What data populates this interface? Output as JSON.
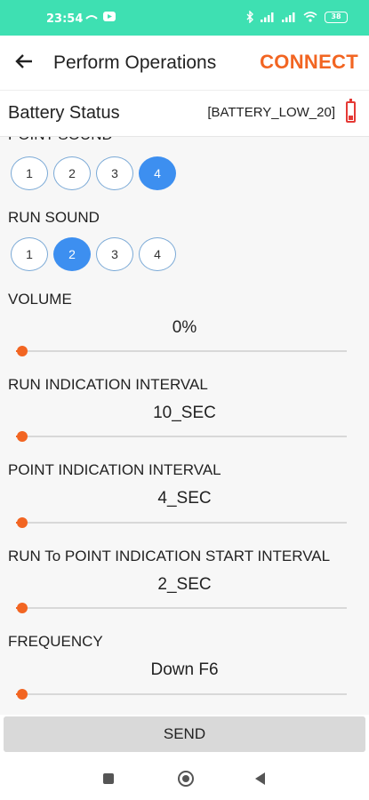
{
  "status_bar": {
    "time": "23:54",
    "battery_level": "38"
  },
  "app_bar": {
    "title": "Perform Operations",
    "connect_label": "CONNECT",
    "accent_color": "#f26522"
  },
  "battery": {
    "label": "Battery Status",
    "value": "[BATTERY_LOW_20]"
  },
  "point_sound": {
    "label": "POINT SOUND",
    "options": [
      "1",
      "2",
      "3",
      "4"
    ],
    "selected": "4"
  },
  "run_sound": {
    "label": "RUN SOUND",
    "options": [
      "1",
      "2",
      "3",
      "4"
    ],
    "selected": "2"
  },
  "volume": {
    "label": "VOLUME",
    "value": "0%",
    "slider_level": 0.02
  },
  "run_indication_interval": {
    "label": "RUN INDICATION INTERVAL",
    "value": "10_SEC",
    "slider_level": 0.02
  },
  "point_indication_interval": {
    "label": "POINT INDICATION INTERVAL",
    "value": "4_SEC",
    "slider_level": 0.02
  },
  "run_to_point_interval": {
    "label": "RUN To POINT INDICATION START INTERVAL",
    "value": "2_SEC",
    "slider_level": 0.02
  },
  "frequency": {
    "label": "FREQUENCY",
    "value": "Down F6",
    "slider_level": 0.02
  },
  "send_label": "SEND",
  "colors": {
    "status_bar": "#3ee0b2",
    "selected_option": "#3d8ff0",
    "slider": "#f26522",
    "battery_low": "#e53935"
  }
}
